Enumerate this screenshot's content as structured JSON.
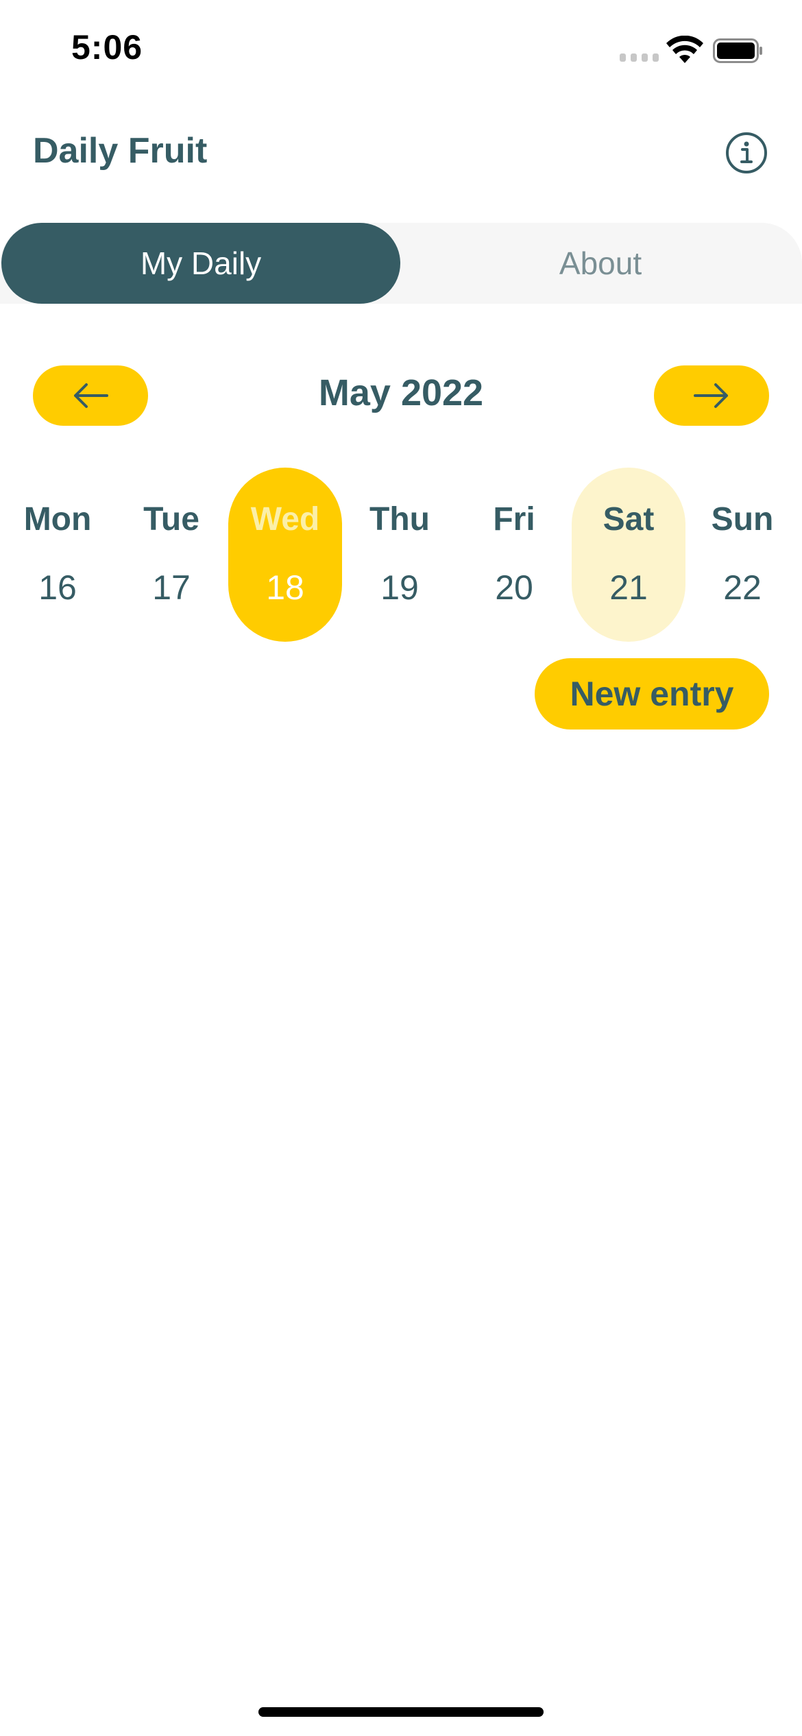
{
  "status_bar": {
    "time": "5:06",
    "icons": [
      "signal-icon",
      "wifi-icon",
      "battery-icon"
    ]
  },
  "header": {
    "title": "Daily Fruit",
    "info_icon": "info-icon"
  },
  "tabs": [
    {
      "label": "My Daily",
      "active": true
    },
    {
      "label": "About",
      "active": false
    }
  ],
  "calendar": {
    "month_label": "May 2022",
    "prev_icon": "arrow-left-icon",
    "next_icon": "arrow-right-icon",
    "days": [
      {
        "name": "Mon",
        "number": "16",
        "state": "normal"
      },
      {
        "name": "Tue",
        "number": "17",
        "state": "normal"
      },
      {
        "name": "Wed",
        "number": "18",
        "state": "selected"
      },
      {
        "name": "Thu",
        "number": "19",
        "state": "normal"
      },
      {
        "name": "Fri",
        "number": "20",
        "state": "normal"
      },
      {
        "name": "Sat",
        "number": "21",
        "state": "today"
      },
      {
        "name": "Sun",
        "number": "22",
        "state": "normal"
      }
    ]
  },
  "actions": {
    "new_entry_label": "New entry"
  },
  "colors": {
    "primary": "#365C64",
    "accent": "#FFCC00",
    "accent_light": "#FDF4CC",
    "tab_background": "#F6F6F6"
  }
}
